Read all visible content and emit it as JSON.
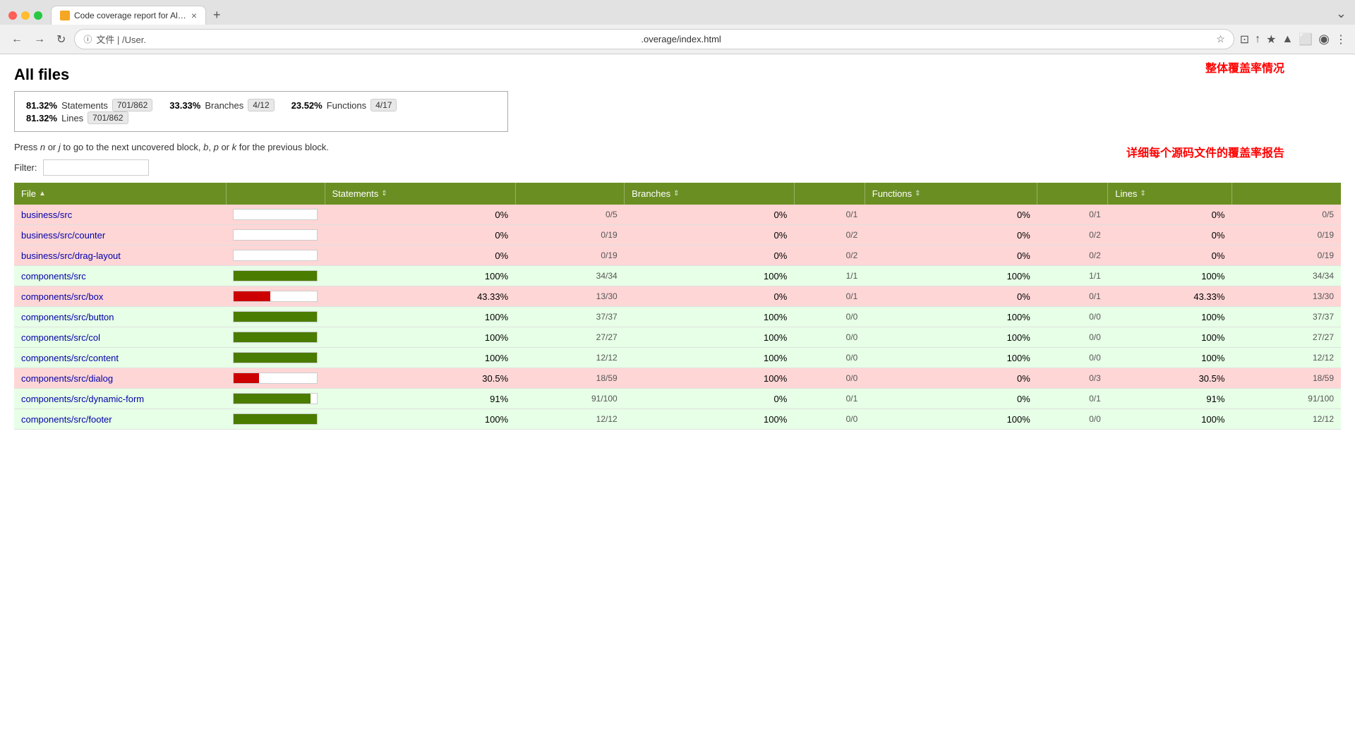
{
  "browser": {
    "tab_title": "Code coverage report for All fi...",
    "tab_favicon_alt": "page-favicon",
    "new_tab_label": "+",
    "address_prefix": "文件 | /User.",
    "address_url": ".overage/index.html",
    "nav": {
      "back": "←",
      "forward": "→",
      "refresh": "↻"
    }
  },
  "page": {
    "title": "All files",
    "instructions": "Press n or j to go to the next uncovered block, b, p or k for the previous block.",
    "filter_label": "Filter:",
    "filter_placeholder": ""
  },
  "summary": {
    "items": [
      {
        "pct": "81.32%",
        "label": "Statements",
        "fraction": "701/862"
      },
      {
        "pct": "33.33%",
        "label": "Branches",
        "fraction": "4/12"
      },
      {
        "pct": "23.52%",
        "label": "Functions",
        "fraction": "4/17"
      },
      {
        "pct": "81.32%",
        "label": "Lines",
        "fraction": "701/862"
      }
    ]
  },
  "annotations": {
    "overall": "整体覆盖率情况",
    "detail": "详细每个源码文件的覆盖率报告"
  },
  "table": {
    "headers": [
      {
        "label": "File",
        "sort": "▲"
      },
      {
        "label": "Statements",
        "sort": "⇕"
      },
      {
        "label": "",
        "sort": ""
      },
      {
        "label": "Branches",
        "sort": "⇕"
      },
      {
        "label": "",
        "sort": ""
      },
      {
        "label": "Functions",
        "sort": "⇕"
      },
      {
        "label": "",
        "sort": ""
      },
      {
        "label": "Lines",
        "sort": "⇕"
      },
      {
        "label": "",
        "sort": ""
      }
    ],
    "rows": [
      {
        "file": "business/src",
        "coverage": 0,
        "bar_pct": 0,
        "bar_type": "none",
        "stmt_pct": "0%",
        "stmt_frac": "0/5",
        "branch_pct": "0%",
        "branch_frac": "0/1",
        "func_pct": "0%",
        "func_frac": "0/1",
        "line_pct": "0%",
        "line_frac": "0/5",
        "row_class": "low"
      },
      {
        "file": "business/src/counter",
        "coverage": 0,
        "bar_pct": 0,
        "bar_type": "none",
        "stmt_pct": "0%",
        "stmt_frac": "0/19",
        "branch_pct": "0%",
        "branch_frac": "0/2",
        "func_pct": "0%",
        "func_frac": "0/2",
        "line_pct": "0%",
        "line_frac": "0/19",
        "row_class": "low"
      },
      {
        "file": "business/src/drag-layout",
        "coverage": 0,
        "bar_pct": 0,
        "bar_type": "none",
        "stmt_pct": "0%",
        "stmt_frac": "0/19",
        "branch_pct": "0%",
        "branch_frac": "0/2",
        "func_pct": "0%",
        "func_frac": "0/2",
        "line_pct": "0%",
        "line_frac": "0/19",
        "row_class": "low"
      },
      {
        "file": "components/src",
        "coverage": 100,
        "bar_pct": 100,
        "bar_type": "green",
        "stmt_pct": "100%",
        "stmt_frac": "34/34",
        "branch_pct": "100%",
        "branch_frac": "1/1",
        "func_pct": "100%",
        "func_frac": "1/1",
        "line_pct": "100%",
        "line_frac": "34/34",
        "row_class": "high"
      },
      {
        "file": "components/src/box",
        "coverage": 43,
        "bar_pct": 43,
        "bar_type": "mixed",
        "stmt_pct": "43.33%",
        "stmt_frac": "13/30",
        "branch_pct": "0%",
        "branch_frac": "0/1",
        "func_pct": "0%",
        "func_frac": "0/1",
        "line_pct": "43.33%",
        "line_frac": "13/30",
        "row_class": "low"
      },
      {
        "file": "components/src/button",
        "coverage": 100,
        "bar_pct": 100,
        "bar_type": "green",
        "stmt_pct": "100%",
        "stmt_frac": "37/37",
        "branch_pct": "100%",
        "branch_frac": "0/0",
        "func_pct": "100%",
        "func_frac": "0/0",
        "line_pct": "100%",
        "line_frac": "37/37",
        "row_class": "high"
      },
      {
        "file": "components/src/col",
        "coverage": 100,
        "bar_pct": 100,
        "bar_type": "green",
        "stmt_pct": "100%",
        "stmt_frac": "27/27",
        "branch_pct": "100%",
        "branch_frac": "0/0",
        "func_pct": "100%",
        "func_frac": "0/0",
        "line_pct": "100%",
        "line_frac": "27/27",
        "row_class": "high"
      },
      {
        "file": "components/src/content",
        "coverage": 100,
        "bar_pct": 100,
        "bar_type": "green",
        "stmt_pct": "100%",
        "stmt_frac": "12/12",
        "branch_pct": "100%",
        "branch_frac": "0/0",
        "func_pct": "100%",
        "func_frac": "0/0",
        "line_pct": "100%",
        "line_frac": "12/12",
        "row_class": "high"
      },
      {
        "file": "components/src/dialog",
        "coverage": 30,
        "bar_pct": 30,
        "bar_type": "mixed",
        "stmt_pct": "30.5%",
        "stmt_frac": "18/59",
        "branch_pct": "100%",
        "branch_frac": "0/0",
        "func_pct": "0%",
        "func_frac": "0/3",
        "line_pct": "30.5%",
        "line_frac": "18/59",
        "row_class": "low"
      },
      {
        "file": "components/src/dynamic-form",
        "coverage": 91,
        "bar_pct": 91,
        "bar_type": "green-partial",
        "stmt_pct": "91%",
        "stmt_frac": "91/100",
        "branch_pct": "0%",
        "branch_frac": "0/1",
        "func_pct": "0%",
        "func_frac": "0/1",
        "line_pct": "91%",
        "line_frac": "91/100",
        "row_class": "high"
      },
      {
        "file": "components/src/footer",
        "coverage": 100,
        "bar_pct": 100,
        "bar_type": "green",
        "stmt_pct": "100%",
        "stmt_frac": "12/12",
        "branch_pct": "100%",
        "branch_frac": "0/0",
        "func_pct": "100%",
        "func_frac": "0/0",
        "line_pct": "100%",
        "line_frac": "12/12",
        "row_class": "high"
      }
    ]
  }
}
